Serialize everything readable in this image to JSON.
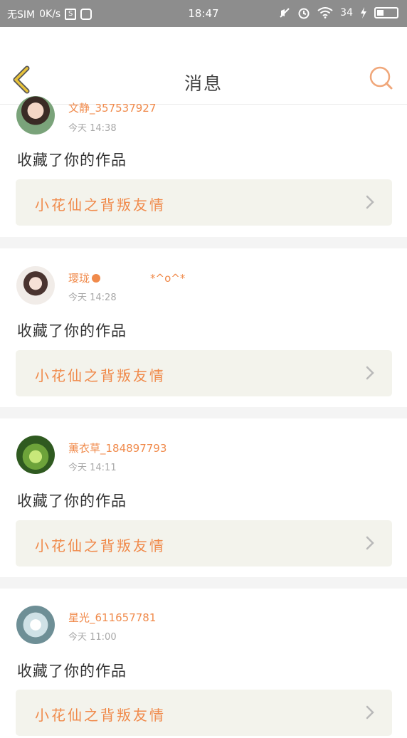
{
  "status_bar": {
    "sim": "无SIM",
    "speed": "0K/s",
    "time": "18:47",
    "battery": "34"
  },
  "header": {
    "title": "消息",
    "accent": "#f08a4b"
  },
  "messages": [
    {
      "user": "文静_357537927",
      "time": "今天 14:38",
      "action": "收藏了你的作品",
      "work_title": "小花仙之背叛友情"
    },
    {
      "user": "璎珑",
      "user_suffix": "*^o^*",
      "time": "今天 14:28",
      "action": "收藏了你的作品",
      "work_title": "小花仙之背叛友情"
    },
    {
      "user": "薰衣草_184897793",
      "time": "今天 14:11",
      "action": "收藏了你的作品",
      "work_title": "小花仙之背叛友情"
    },
    {
      "user": "星光_611657781",
      "time": "今天 11:00",
      "action": "收藏了你的作品",
      "work_title": "小花仙之背叛友情"
    }
  ]
}
